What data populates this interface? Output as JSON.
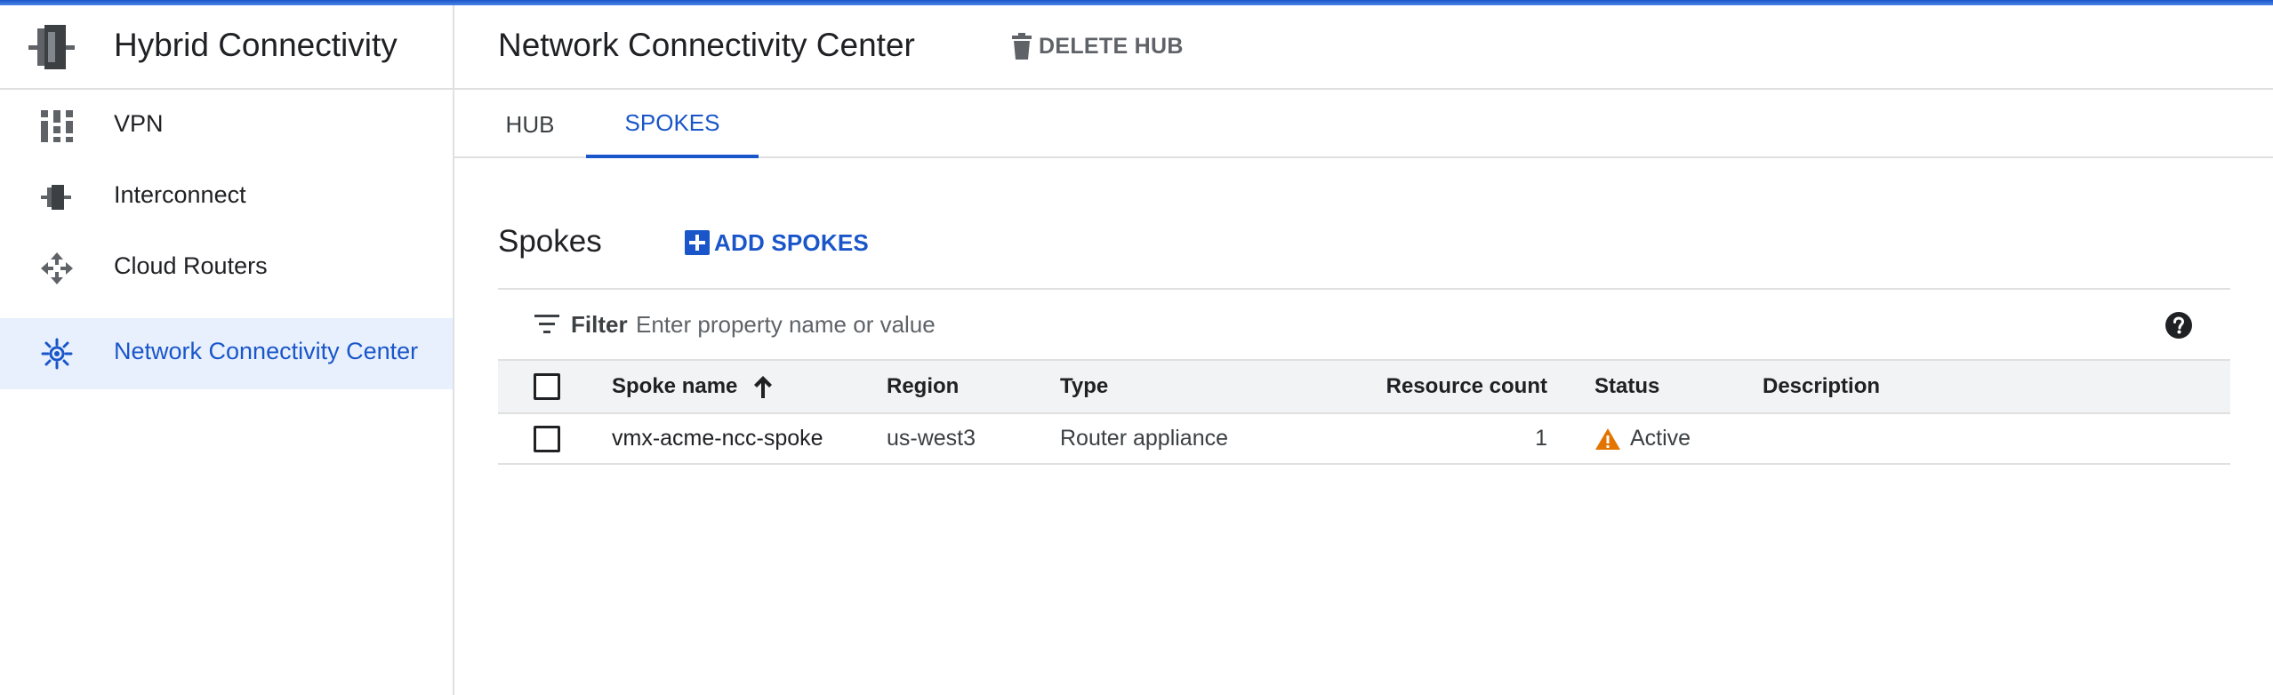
{
  "colors": {
    "accent": "#1a56c9",
    "warning": "#e37400",
    "active_nav_bg": "#e8f0fe"
  },
  "app": {
    "title": "Hybrid Connectivity",
    "logo_icon": "hybrid-connectivity-icon"
  },
  "sidebar": {
    "items": [
      {
        "label": "VPN",
        "icon": "vpn-icon",
        "active": false
      },
      {
        "label": "Interconnect",
        "icon": "interconnect-icon",
        "active": false
      },
      {
        "label": "Cloud Routers",
        "icon": "cloud-router-icon",
        "active": false
      },
      {
        "label": "Network Connectivity Center",
        "icon": "network-connectivity-icon",
        "active": true
      }
    ]
  },
  "header": {
    "title": "Network Connectivity Center",
    "delete_label": "DELETE HUB",
    "delete_icon": "trash-icon"
  },
  "tabs": [
    {
      "label": "HUB",
      "active": false
    },
    {
      "label": "SPOKES",
      "active": true
    }
  ],
  "spokes": {
    "title": "Spokes",
    "add_label": "ADD SPOKES",
    "add_icon": "add-box-icon",
    "filter": {
      "label": "Filter",
      "placeholder": "Enter property name or value",
      "value": ""
    },
    "columns": {
      "name": "Spoke name",
      "region": "Region",
      "type": "Type",
      "resource_count": "Resource count",
      "status": "Status",
      "description": "Description"
    },
    "sort": {
      "column": "Spoke name",
      "direction": "ascending"
    },
    "rows": [
      {
        "name": "vmx-acme-ncc-spoke",
        "region": "us-west3",
        "type": "Router appliance",
        "resource_count": "1",
        "status": "Active",
        "status_icon": "warning-icon",
        "description": ""
      }
    ]
  }
}
